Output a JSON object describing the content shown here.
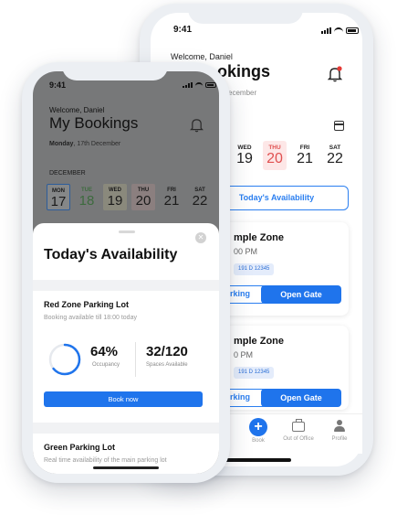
{
  "colors": {
    "accent": "#1f74ec",
    "alert_red": "#e05050",
    "tue_green": "#3d6b3e"
  },
  "back_phone": {
    "status_time": "9:41",
    "welcome": "Welcome, Daniel",
    "title_partial": "okings",
    "date_partial": "ecember",
    "calendar_icon": "calendar-icon",
    "days": [
      {
        "name": "WED",
        "num": "19"
      },
      {
        "name": "THU",
        "num": "20"
      },
      {
        "name": "FRI",
        "num": "21"
      },
      {
        "name": "SAT",
        "num": "22"
      }
    ],
    "availability_button": "Today's Availability",
    "bookings": [
      {
        "zone": "mple Zone",
        "time": "00 PM",
        "plate": "191 D 12345",
        "parking_label": "rking",
        "open_label": "Open Gate"
      },
      {
        "zone": "mple Zone",
        "time": "0 PM",
        "plate": "191 D 12345",
        "parking_label": "rking",
        "open_label": "Open Gate"
      }
    ],
    "tabs": [
      {
        "label": "Book",
        "icon": "plus-icon"
      },
      {
        "label": "Out of Office",
        "icon": "briefcase-icon"
      },
      {
        "label": "Profile",
        "icon": "person-icon"
      }
    ]
  },
  "front_phone": {
    "status_time": "9:41",
    "welcome": "Welcome, Daniel",
    "title": "My Bookings",
    "date_day": "Monday",
    "date_rest": ", 17th December",
    "month": "DECEMBER",
    "days": [
      {
        "name": "MON",
        "num": "17"
      },
      {
        "name": "TUE",
        "num": "18"
      },
      {
        "name": "WED",
        "num": "19"
      },
      {
        "name": "THU",
        "num": "20"
      },
      {
        "name": "FRI",
        "num": "21"
      },
      {
        "name": "SAT",
        "num": "22"
      }
    ],
    "sheet": {
      "title": "Today's Availability",
      "lots": [
        {
          "name": "Red Zone Parking Lot",
          "subtitle": "Booking available till 18:00 today",
          "occupancy_pct": "64%",
          "occupancy_label": "Occupancy",
          "occupancy_value": 0.64,
          "spaces": "32/120",
          "spaces_label": "Spaces Available",
          "button": "Book now"
        },
        {
          "name": "Green Parking Lot",
          "subtitle": "Real time availability of the main parking lot"
        }
      ]
    }
  }
}
